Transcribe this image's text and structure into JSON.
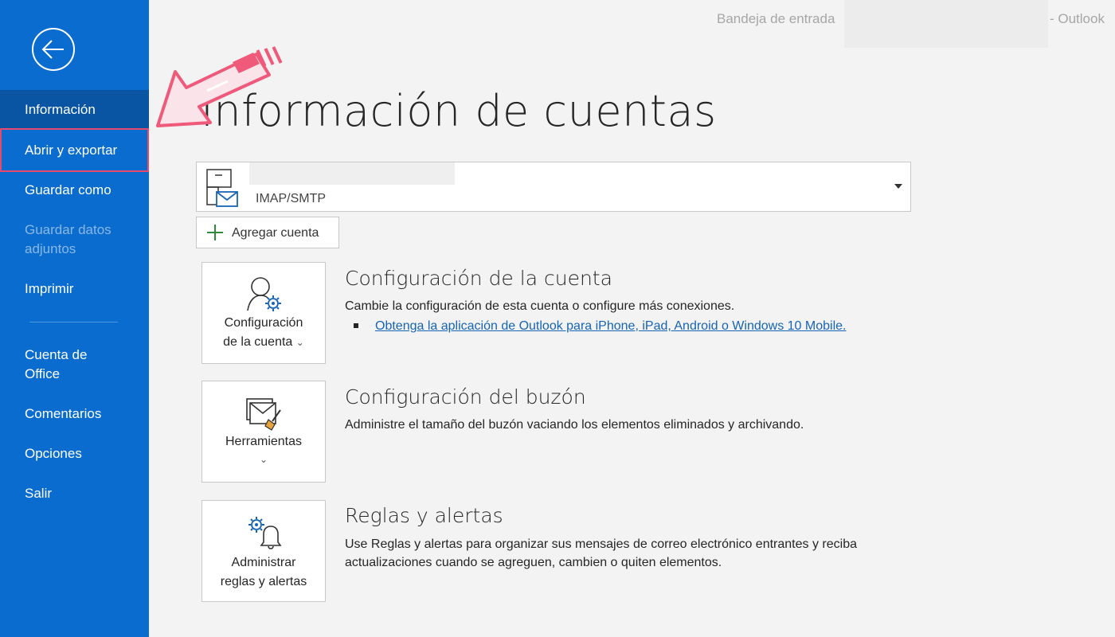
{
  "window": {
    "title_left": "Bandeja de entrada",
    "title_right": "-  Outlook"
  },
  "sidebar": {
    "back_icon": "arrow-left-circle-icon",
    "items": [
      {
        "label": "Información"
      },
      {
        "label": "Abrir y exportar"
      },
      {
        "label": "Guardar como"
      },
      {
        "label": "Guardar datos adjuntos"
      },
      {
        "label": "Imprimir"
      },
      {
        "label": "Cuenta de Office"
      },
      {
        "label": "Comentarios"
      },
      {
        "label": "Opciones"
      },
      {
        "label": "Salir"
      }
    ]
  },
  "main": {
    "title": "Información de cuentas",
    "account": {
      "type": "IMAP/SMTP",
      "icon": "mailbox-icon"
    },
    "add_account_label": "Agregar cuenta",
    "sections": [
      {
        "tile_label_line1": "Configuración",
        "tile_label_line2": "de la cuenta",
        "tile_icon": "account-settings-icon",
        "title": "Configuración de la cuenta",
        "description": "Cambie la configuración de esta cuenta o configure más conexiones.",
        "link": "Obtenga la aplicación de Outlook para iPhone, iPad, Android o Windows 10 Mobile."
      },
      {
        "tile_label_line1": "Herramientas",
        "tile_icon": "mailbox-cleanup-icon",
        "title": "Configuración del buzón",
        "description": "Administre el tamaño del buzón vaciando los elementos eliminados y archivando."
      },
      {
        "tile_label_line1": "Administrar",
        "tile_label_line2": "reglas y alertas",
        "tile_icon": "rules-alerts-icon",
        "title": "Reglas y alertas",
        "description_line1": "Use Reglas y alertas para organizar sus mensajes de correo electrónico entrantes y reciba",
        "description_line2": "actualizaciones cuando se agreguen, cambien o quiten elementos."
      }
    ]
  },
  "colors": {
    "sidebar_bg": "#0a6ccf",
    "sidebar_active": "#0955a4",
    "highlight_outline": "#e84a6d",
    "link": "#1664b5"
  }
}
